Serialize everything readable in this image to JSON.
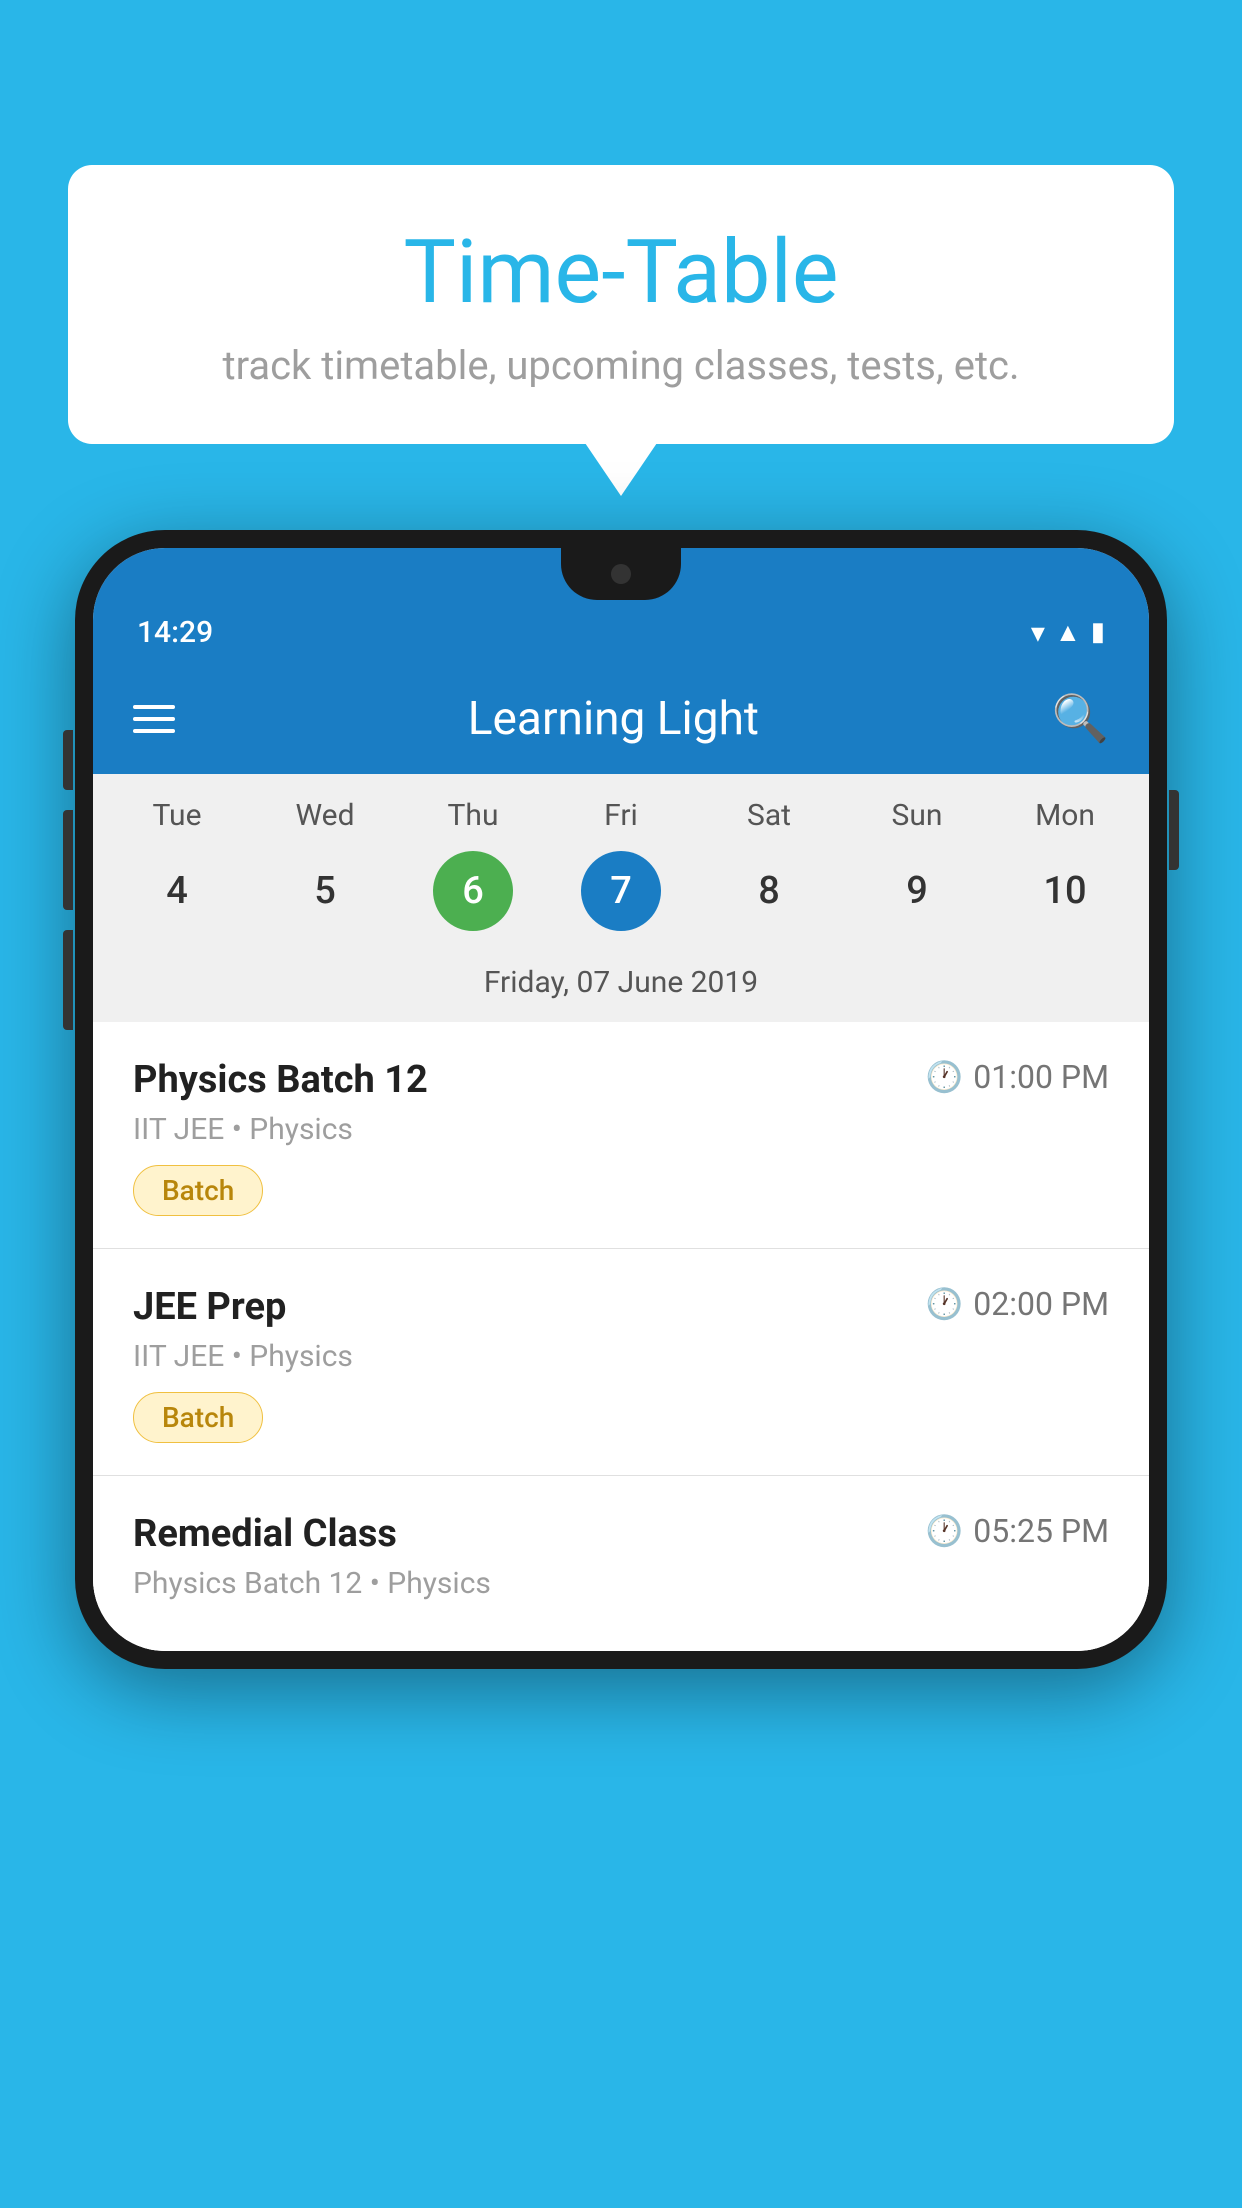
{
  "background_color": "#29b6e8",
  "speech_bubble": {
    "title": "Time-Table",
    "subtitle": "track timetable, upcoming classes, tests, etc."
  },
  "phone": {
    "status_bar": {
      "time": "14:29"
    },
    "app_bar": {
      "title": "Learning Light"
    },
    "calendar": {
      "days": [
        "Tue",
        "Wed",
        "Thu",
        "Fri",
        "Sat",
        "Sun",
        "Mon"
      ],
      "dates": [
        {
          "num": "4",
          "state": "normal"
        },
        {
          "num": "5",
          "state": "normal"
        },
        {
          "num": "6",
          "state": "today"
        },
        {
          "num": "7",
          "state": "selected"
        },
        {
          "num": "8",
          "state": "normal"
        },
        {
          "num": "9",
          "state": "normal"
        },
        {
          "num": "10",
          "state": "normal"
        }
      ],
      "selected_date_label": "Friday, 07 June 2019"
    },
    "classes": [
      {
        "name": "Physics Batch 12",
        "time": "01:00 PM",
        "meta": "IIT JEE • Physics",
        "badge": "Batch"
      },
      {
        "name": "JEE Prep",
        "time": "02:00 PM",
        "meta": "IIT JEE • Physics",
        "badge": "Batch"
      },
      {
        "name": "Remedial Class",
        "time": "05:25 PM",
        "meta": "Physics Batch 12 • Physics",
        "badge": null
      }
    ]
  }
}
